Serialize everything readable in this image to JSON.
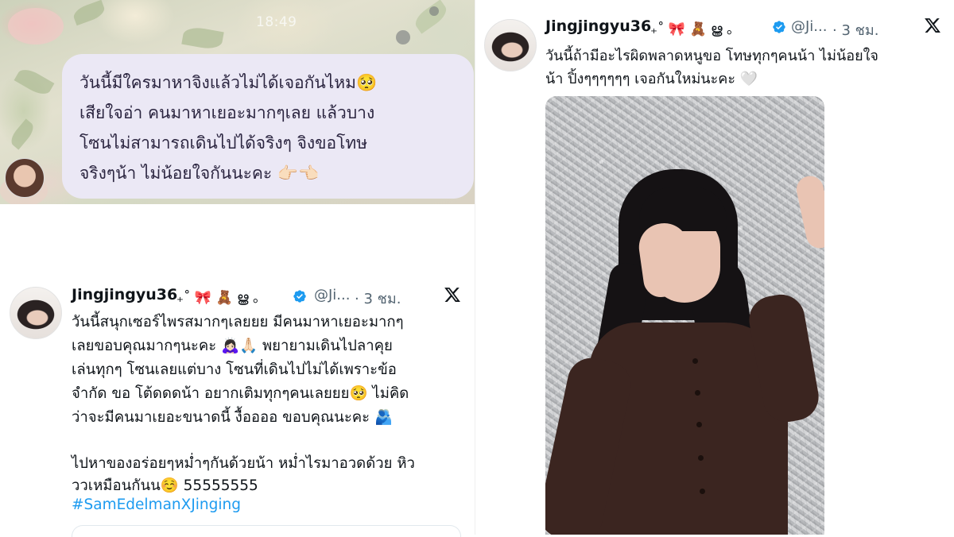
{
  "chat": {
    "time": "18:49",
    "lines": [
      "วันนี้มีใครมาหาจิงแล้วไม่ได้เจอกันไหม🥺",
      "เสียใจอ่า คนมาหาเยอะมากๆเลย แล้วบาง",
      "โซนไม่สามารถเดินไปได้จริงๆ จิงขอโทษ",
      "จริงๆน้า ไม่น้อยใจกันนะคะ 👉🏻👈🏻"
    ]
  },
  "tweet_left": {
    "name": "Jingjingyu36",
    "decorations": "₊˚ 🎀 🧸 ൠ ｡",
    "handle": "@Ji...",
    "time": "· 3 ชม.",
    "lines": [
      "วันนี้สนุกเซอร์ไพรสมากๆเลยยย มีคนมาหาเยอะมากๆ",
      "เลยขอบคุณมากๆนะคะ 🙇🏻‍♀️🙏🏻 พยายามเดินไปลาคุย",
      "เล่นทุกๆ โซนเลยแต่บาง โซนที่เดินไปไม่ได้เพราะข้อ",
      "จำกัด ขอ โต้ดดดน้า อยากเติมทุกๆคนเลยยย🥺 ไม่คิด",
      "ว่าจะมีคนมาเยอะขนาดนี้ งื้ออออ ขอบคุณนะคะ 🫂",
      "",
      "ไปหาของอร่อยๆหม่ำๆกันด้วยน้า หม่ำไรมาอวดด้วย หิว",
      "ววเหมือนกันน☺️ 55555555"
    ],
    "hashtag": "#SamEdelmanXJinging"
  },
  "tweet_right": {
    "name": "Jingjingyu36",
    "decorations": "₊˚ 🎀 🧸 ൠ ｡",
    "handle": "@Ji...",
    "time": "· 3 ชม.",
    "lines": [
      "วันนี้ถ้ามีอะไรผิดพลาดหนูขอ โทษทุกๆคนน้า ไม่น้อยใจ",
      "น้า ปิ้งๆๆๆๆๆๆ เจอกันใหม่นะคะ 🤍"
    ],
    "photo_alt": ""
  },
  "colors": {
    "bubble": "#ebe8f5",
    "verified": "#1d9bf0",
    "hashtag": "#1d9bf0",
    "text": "#0f1419",
    "muted": "#536471"
  },
  "icons": {
    "x_logo": "x-logo-icon",
    "verified": "verified-badge-icon"
  }
}
